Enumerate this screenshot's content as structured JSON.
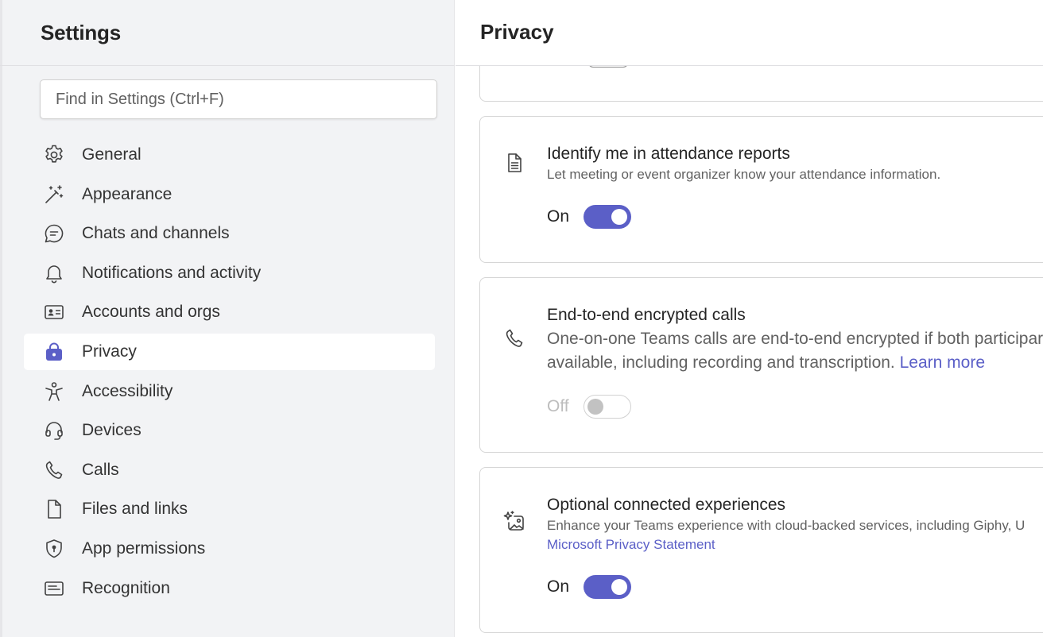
{
  "sidebar": {
    "title": "Settings",
    "search_placeholder": "Find in Settings (Ctrl+F)",
    "items": [
      {
        "label": "General",
        "icon": "gear-icon"
      },
      {
        "label": "Appearance",
        "icon": "magic-wand-icon"
      },
      {
        "label": "Chats and channels",
        "icon": "chat-bubble-icon"
      },
      {
        "label": "Notifications and activity",
        "icon": "bell-icon"
      },
      {
        "label": "Accounts and orgs",
        "icon": "contact-card-icon"
      },
      {
        "label": "Privacy",
        "icon": "lock-icon",
        "active": true
      },
      {
        "label": "Accessibility",
        "icon": "accessibility-icon"
      },
      {
        "label": "Devices",
        "icon": "headset-icon"
      },
      {
        "label": "Calls",
        "icon": "phone-icon"
      },
      {
        "label": "Files and links",
        "icon": "document-icon"
      },
      {
        "label": "App permissions",
        "icon": "shield-icon"
      },
      {
        "label": "Recognition",
        "icon": "text-box-icon"
      }
    ]
  },
  "main": {
    "title": "Privacy",
    "cards": [
      {
        "icon": "document-text-icon",
        "title": "Identify me in attendance reports",
        "description": "Let meeting or event organizer know your attendance information.",
        "toggle_label": "On",
        "toggle_state": "on"
      },
      {
        "icon": "phone-icon",
        "title": "End-to-end encrypted calls",
        "description_line1": "One-on-one Teams calls are end-to-end encrypted if both participar",
        "description_line2": "available, including recording and transcription.",
        "link": "Learn more",
        "toggle_label": "Off",
        "toggle_state": "off"
      },
      {
        "icon": "sparkle-image-icon",
        "title": "Optional connected experiences",
        "description": "Enhance your Teams experience with cloud-backed services, including Giphy, U",
        "link": "Microsoft Privacy Statement",
        "toggle_label": "On",
        "toggle_state": "on"
      }
    ]
  },
  "colors": {
    "accent": "#5b5fc7",
    "sidebar_bg": "#f2f3f5",
    "text": "#242424",
    "muted": "#616161"
  }
}
